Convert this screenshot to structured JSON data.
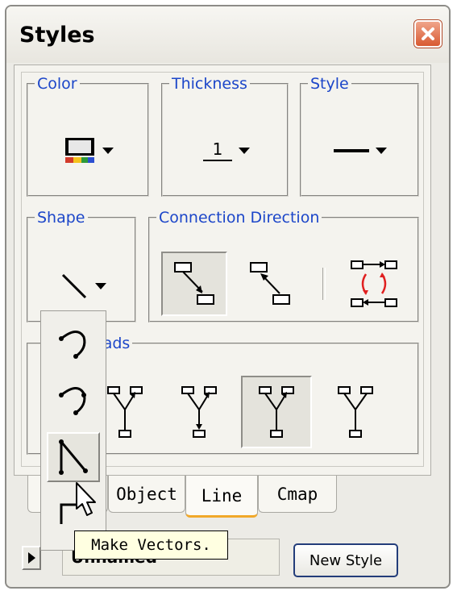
{
  "window": {
    "title": "Styles",
    "close_icon": "close-x-icon"
  },
  "sections": {
    "color": {
      "label": "Color",
      "icon": "color-swatch-icon"
    },
    "thickness": {
      "label": "Thickness",
      "value": "1"
    },
    "style": {
      "label": "Style",
      "icon": "solid-line-icon"
    },
    "shape": {
      "label": "Shape",
      "icon": "straight-line-icon"
    },
    "connection_direction": {
      "label": "Connection Direction",
      "options": [
        "forward-arrow-icon",
        "backward-arrow-icon",
        "bidirectional-icon"
      ],
      "selected_index": 0
    },
    "arrowheads": {
      "label_visible": "eads",
      "options": [
        "arrowhead-up-icon",
        "arrowhead-both-icon",
        "arrowhead-none-icon",
        "arrowhead-plain-icon"
      ],
      "selected_index": 2
    }
  },
  "tabs": [
    {
      "label": "Object",
      "active": false
    },
    {
      "label": "Line",
      "active": true
    },
    {
      "label": "Cmap",
      "active": false
    }
  ],
  "footer": {
    "style_name": "Unnamed",
    "new_style_button": "New Style"
  },
  "shape_popup": {
    "options": [
      "curve-open-icon",
      "curve-dotted-icon",
      "vectors-icon",
      "elbow-icon"
    ],
    "selected_index": 2
  },
  "tooltip": "Make Vectors.",
  "colors": {
    "legend_text": "#1c46c9",
    "close_button": "#d85a32",
    "active_tab_underline": "#f1a829",
    "tooltip_bg": "#ffffe1"
  }
}
